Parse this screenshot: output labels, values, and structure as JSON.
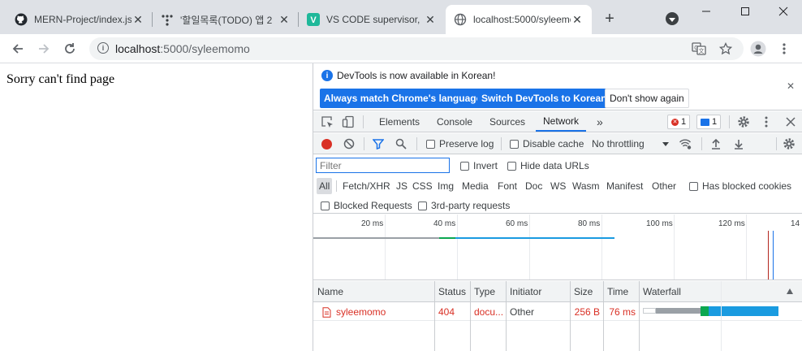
{
  "tabs": [
    {
      "title": "MERN-Project/index.js",
      "icon": "github-icon"
    },
    {
      "title": "'할일목록(TODO) 앱 2",
      "icon": "dots-logo-icon"
    },
    {
      "title": "VS CODE supervisor,",
      "icon": "v-logo-icon"
    },
    {
      "title": "localhost:5000/syleemomo",
      "icon": "globe-icon"
    }
  ],
  "address": {
    "host": "localhost",
    "path": ":5000/syleemomo"
  },
  "page": {
    "message": "Sorry can't find page"
  },
  "devtools": {
    "infobar": {
      "message": "DevTools is now available in Korean!",
      "btn_match": "Always match Chrome's language",
      "btn_switch": "Switch DevTools to Korean",
      "btn_dont": "Don't show again"
    },
    "panels": [
      "Elements",
      "Console",
      "Sources",
      "Network"
    ],
    "active_panel": "Network",
    "more": "»",
    "error_count": "1",
    "message_count": "1",
    "preserve_log": "Preserve log",
    "disable_cache": "Disable cache",
    "throttling": "No throttling",
    "filter_placeholder": "Filter",
    "invert": "Invert",
    "hide_data_urls": "Hide data URLs",
    "types": [
      "All",
      "Fetch/XHR",
      "JS",
      "CSS",
      "Img",
      "Media",
      "Font",
      "Doc",
      "WS",
      "Wasm",
      "Manifest",
      "Other"
    ],
    "has_blocked_cookies": "Has blocked cookies",
    "blocked_requests": "Blocked Requests",
    "third_party": "3rd-party requests",
    "timeline_ticks": [
      "20 ms",
      "40 ms",
      "60 ms",
      "80 ms",
      "100 ms",
      "120 ms",
      "14"
    ],
    "columns": [
      "Name",
      "Status",
      "Type",
      "Initiator",
      "Size",
      "Time",
      "Waterfall"
    ],
    "rows": [
      {
        "name": "syleemomo",
        "status": "404",
        "type": "docu...",
        "initiator": "Other",
        "size": "256 B",
        "time": "76 ms"
      }
    ]
  },
  "colors": {
    "accent": "#1a73e8",
    "error": "#d93025",
    "waterfall_blue": "#1a9be0",
    "waterfall_green": "#0ca750",
    "waterfall_gray": "#9aa0a6"
  }
}
